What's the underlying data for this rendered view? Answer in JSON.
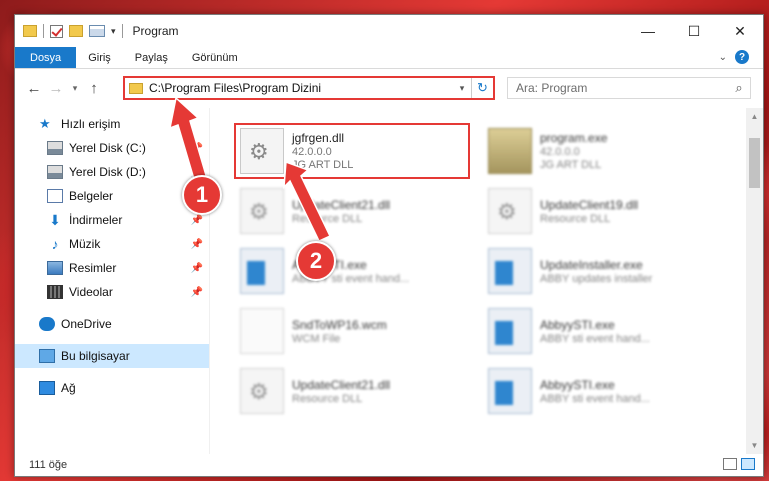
{
  "window": {
    "title": "Program",
    "minimize_glyph": "—",
    "maximize_glyph": "☐",
    "close_glyph": "✕"
  },
  "quick_access_toolbar": {
    "dropdown_glyph": "▾"
  },
  "ribbon": {
    "tabs": [
      {
        "label": "Dosya"
      },
      {
        "label": "Giriş"
      },
      {
        "label": "Paylaş"
      },
      {
        "label": "Görünüm"
      }
    ],
    "expand_glyph": "⌄",
    "help_glyph": "?"
  },
  "navigation": {
    "back_glyph": "←",
    "forward_glyph": "→",
    "recent_glyph": "▾",
    "up_glyph": "↑"
  },
  "address_bar": {
    "path": "C:\\Program Files\\Program Dizini",
    "dropdown_glyph": "▾",
    "refresh_glyph": "↻"
  },
  "search": {
    "placeholder": "Ara: Program",
    "icon": "search-icon",
    "glyph": "⌕"
  },
  "sidebar": {
    "items": [
      {
        "label": "Hızlı erişim",
        "icon": "star-icon",
        "glyph": "★"
      },
      {
        "label": "Yerel Disk (C:)",
        "icon": "drive-icon",
        "pinned": true
      },
      {
        "label": "Yerel Disk (D:)",
        "icon": "drive-icon",
        "pinned": true
      },
      {
        "label": "Belgeler",
        "icon": "document-icon",
        "pinned": false
      },
      {
        "label": "İndirmeler",
        "icon": "download-icon",
        "glyph": "⬇",
        "pinned": true
      },
      {
        "label": "Müzik",
        "icon": "music-icon",
        "glyph": "♪",
        "pinned": true
      },
      {
        "label": "Resimler",
        "icon": "pictures-icon",
        "pinned": true
      },
      {
        "label": "Videolar",
        "icon": "videos-icon",
        "pinned": true
      },
      {
        "label": "OneDrive",
        "icon": "onedrive-icon"
      },
      {
        "label": "Bu bilgisayar",
        "icon": "computer-icon",
        "selected": true
      },
      {
        "label": "Ağ",
        "icon": "network-icon"
      }
    ],
    "pin_glyph": "📌"
  },
  "files": [
    {
      "name": "jgfrgen.dll",
      "line2": "42.0.0.0",
      "line3": "JG ART DLL",
      "type": "dll",
      "highlighted": true
    },
    {
      "name": "program.exe",
      "line2": "42.0.0.0",
      "line3": "JG ART DLL",
      "type": "exe2"
    },
    {
      "name": "UpdateClient21.dll",
      "line2": "Resource DLL",
      "line3": "",
      "type": "dll"
    },
    {
      "name": "UpdateClient19.dll",
      "line2": "Resource DLL",
      "line3": "",
      "type": "dll"
    },
    {
      "name": "AbbyySTI.exe",
      "line2": "ABBYY sti event hand...",
      "line3": "",
      "type": "exe"
    },
    {
      "name": "UpdateInstaller.exe",
      "line2": "ABBY updates installer",
      "line3": "",
      "type": "exe"
    },
    {
      "name": "SndToWP16.wcm",
      "line2": "WCM File",
      "line3": "",
      "type": "wcm"
    },
    {
      "name": "AbbyySTI.exe",
      "line2": "ABBY sti event hand...",
      "line3": "",
      "type": "exe"
    },
    {
      "name": "UpdateClient21.dll",
      "line2": "Resource DLL",
      "line3": "",
      "type": "dll"
    },
    {
      "name": "AbbyySTI.exe",
      "line2": "ABBY sti event hand...",
      "line3": "",
      "type": "exe"
    }
  ],
  "status_bar": {
    "item_count": "111 öğe"
  },
  "annotations": [
    {
      "number": "1"
    },
    {
      "number": "2"
    }
  ],
  "colors": {
    "accent": "#1979ca",
    "highlight": "#e53935",
    "selection": "#cce8ff"
  }
}
